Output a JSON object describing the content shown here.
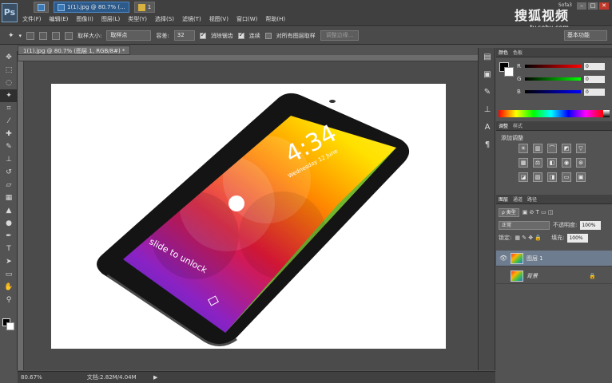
{
  "app": {
    "logo": "Ps"
  },
  "menu": [
    "文件(F)",
    "编辑(E)",
    "图像(I)",
    "图层(L)",
    "类型(Y)",
    "选择(S)",
    "滤镜(T)",
    "视图(V)",
    "窗口(W)",
    "帮助(H)"
  ],
  "title_tabs": [
    {
      "label": "1(1).jpg @ 80.7% (...",
      "icon": "ps-file-icon",
      "active": true
    },
    {
      "label": "1",
      "icon": "folder-icon",
      "active": false
    }
  ],
  "watermark": {
    "main": "搜狐视频",
    "sub": "tv.sohu.com",
    "user": "Sofa3"
  },
  "options": {
    "sample_size_label": "取样大小:",
    "sample_size_value": "取样点",
    "tolerance_label": "容差:",
    "tolerance_value": "32",
    "antialias_label": "消除锯齿",
    "contiguous_label": "连续",
    "sample_all_label": "对所有图层取样",
    "refine_edge_label": "调整边缘...",
    "workspace_value": "基本功能"
  },
  "document": {
    "tab_label": "1(1).jpg @ 80.7% (图层 1, RGB/8#) *"
  },
  "phone": {
    "time": "4:34",
    "date": "Wednesday 12 June",
    "unlock_text": "slide to unlock"
  },
  "status": {
    "zoom": "80.67%",
    "doc_size": "文档:2.82M/4.04M"
  },
  "color_panel": {
    "tabs": [
      "颜色",
      "色板"
    ],
    "channels": [
      {
        "name": "R",
        "value": "0",
        "bar_color": "#d63a3a"
      },
      {
        "name": "G",
        "value": "0",
        "bar_color": "#3ab04a"
      },
      {
        "name": "B",
        "value": "0",
        "bar_color": "#3a5fd6"
      }
    ]
  },
  "adjust_panel": {
    "tabs": [
      "调整",
      "样式"
    ],
    "title": "添加调整"
  },
  "layers_panel": {
    "tabs": [
      "图层",
      "通道",
      "路径"
    ],
    "filter_label": "ρ 类型",
    "blend_mode": "正常",
    "opacity_label": "不透明度:",
    "opacity_value": "100%",
    "lock_label": "锁定:",
    "fill_label": "填充:",
    "fill_value": "100%",
    "layers": [
      {
        "name": "图层 1",
        "selected": true,
        "locked": false
      },
      {
        "name": "背景",
        "selected": false,
        "locked": true
      }
    ]
  }
}
